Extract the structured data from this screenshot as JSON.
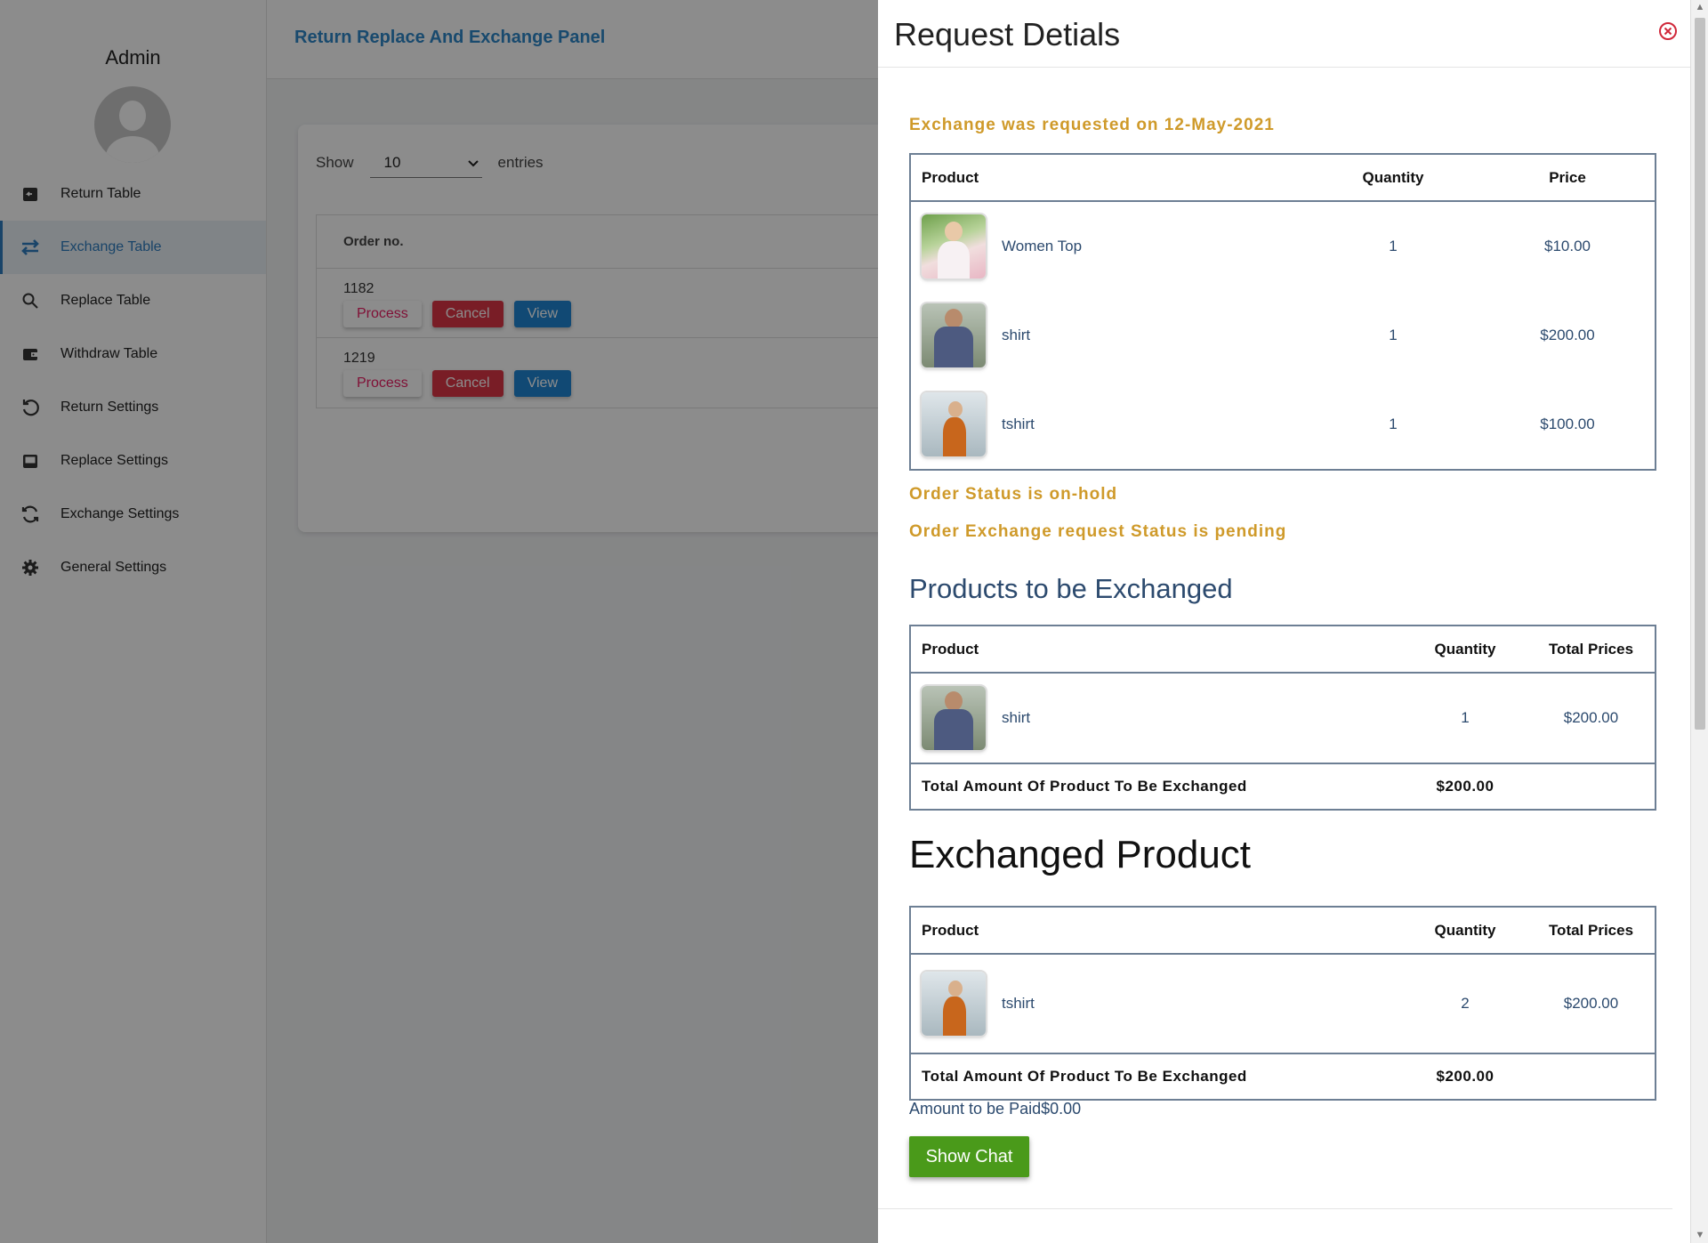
{
  "sidebar": {
    "admin_name": "Admin",
    "items": [
      {
        "label": "Return Table",
        "icon": "return-box-icon"
      },
      {
        "label": "Exchange Table",
        "icon": "exchange-arrows-icon",
        "active": true
      },
      {
        "label": "Replace Table",
        "icon": "search-refresh-icon"
      },
      {
        "label": "Withdraw Table",
        "icon": "wallet-icon"
      },
      {
        "label": "Return Settings",
        "icon": "undo-icon"
      },
      {
        "label": "Replace Settings",
        "icon": "inbox-icon"
      },
      {
        "label": "Exchange Settings",
        "icon": "sync-icon"
      },
      {
        "label": "General Settings",
        "icon": "gear-icon"
      }
    ]
  },
  "header": {
    "title": "Return Replace And Exchange Panel"
  },
  "main": {
    "show_label": "Show",
    "entries_value": "10",
    "entries_label": "entries",
    "column_order": "Order no.",
    "rows": [
      {
        "order": "1182",
        "process": "Process",
        "cancel": "Cancel",
        "view": "View"
      },
      {
        "order": "1219",
        "process": "Process",
        "cancel": "Cancel",
        "view": "View"
      }
    ]
  },
  "drawer": {
    "title": "Request Detials",
    "requested_on": "Exchange was requested on 12-May-2021",
    "order_table": {
      "headers": [
        "Product",
        "Quantity",
        "Price"
      ],
      "rows": [
        {
          "product": "Women Top",
          "quantity": "1",
          "price": "$10.00"
        },
        {
          "product": "shirt",
          "quantity": "1",
          "price": "$200.00"
        },
        {
          "product": "tshirt",
          "quantity": "1",
          "price": "$100.00"
        }
      ]
    },
    "order_status": "Order Status is on-hold",
    "exchange_status": "Order Exchange request Status is pending",
    "to_be_exchanged_title": "Products to be Exchanged",
    "to_be_exchanged": {
      "headers": [
        "Product",
        "Quantity",
        "Total Prices"
      ],
      "rows": [
        {
          "product": "shirt",
          "quantity": "1",
          "total": "$200.00"
        }
      ],
      "footer_label": "Total Amount Of Product To Be Exchanged",
      "footer_total": "$200.00"
    },
    "exchanged_title": "Exchanged Product",
    "exchanged": {
      "headers": [
        "Product",
        "Quantity",
        "Total Prices"
      ],
      "rows": [
        {
          "product": "tshirt",
          "quantity": "2",
          "total": "$200.00"
        }
      ],
      "footer_label": "Total Amount Of Product To Be Exchanged",
      "footer_total": "$200.00"
    },
    "amount_to_be_paid": "Amount to be Paid$0.00",
    "show_chat": "Show Chat"
  }
}
